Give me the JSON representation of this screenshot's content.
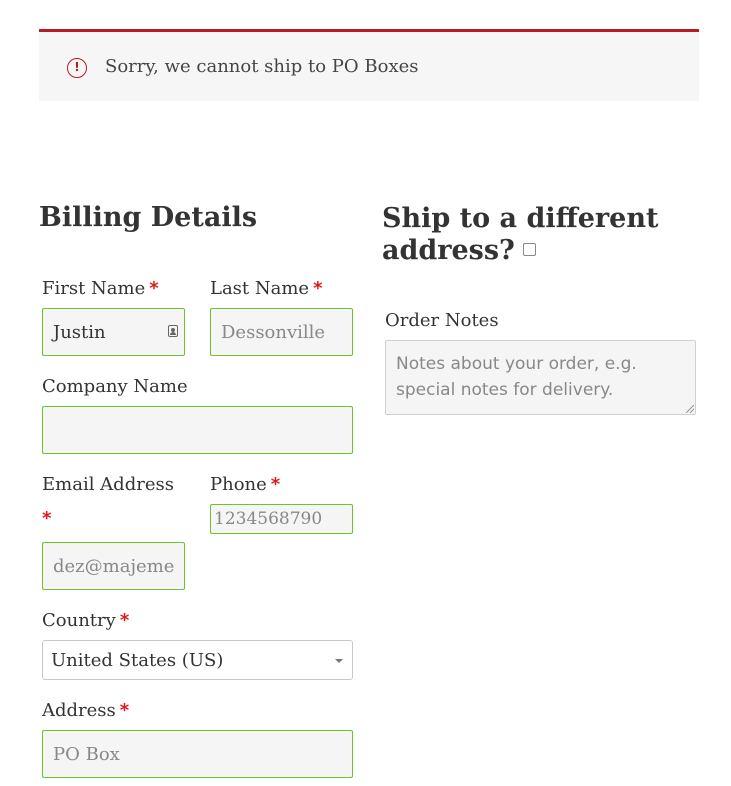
{
  "notice": {
    "icon": "alert-circle-icon",
    "icon_glyph": "!",
    "message": "Sorry, we cannot ship to PO Boxes",
    "accent_color": "#b81c23"
  },
  "billing": {
    "title": "Billing Details",
    "first_name": {
      "label": "First Name",
      "required": "*",
      "value": "Justin"
    },
    "last_name": {
      "label": "Last Name",
      "required": "*",
      "placeholder": "Dessonville"
    },
    "company": {
      "label": "Company Name",
      "value": ""
    },
    "email": {
      "label": "Email Address",
      "required": "*",
      "placeholder": "dez@majeme"
    },
    "phone": {
      "label": "Phone",
      "required": "*",
      "placeholder": "1234568790"
    },
    "country": {
      "label": "Country",
      "required": "*",
      "selected": "United States (US)"
    },
    "address": {
      "label": "Address",
      "required": "*",
      "placeholder": "PO Box"
    }
  },
  "shipping": {
    "title": "Ship to a different address?"
  },
  "order_notes": {
    "label": "Order Notes",
    "placeholder": "Notes about your order, e.g. special notes for delivery."
  },
  "colors": {
    "valid_border": "#6dc22e",
    "required_marker": "#e2191c"
  }
}
